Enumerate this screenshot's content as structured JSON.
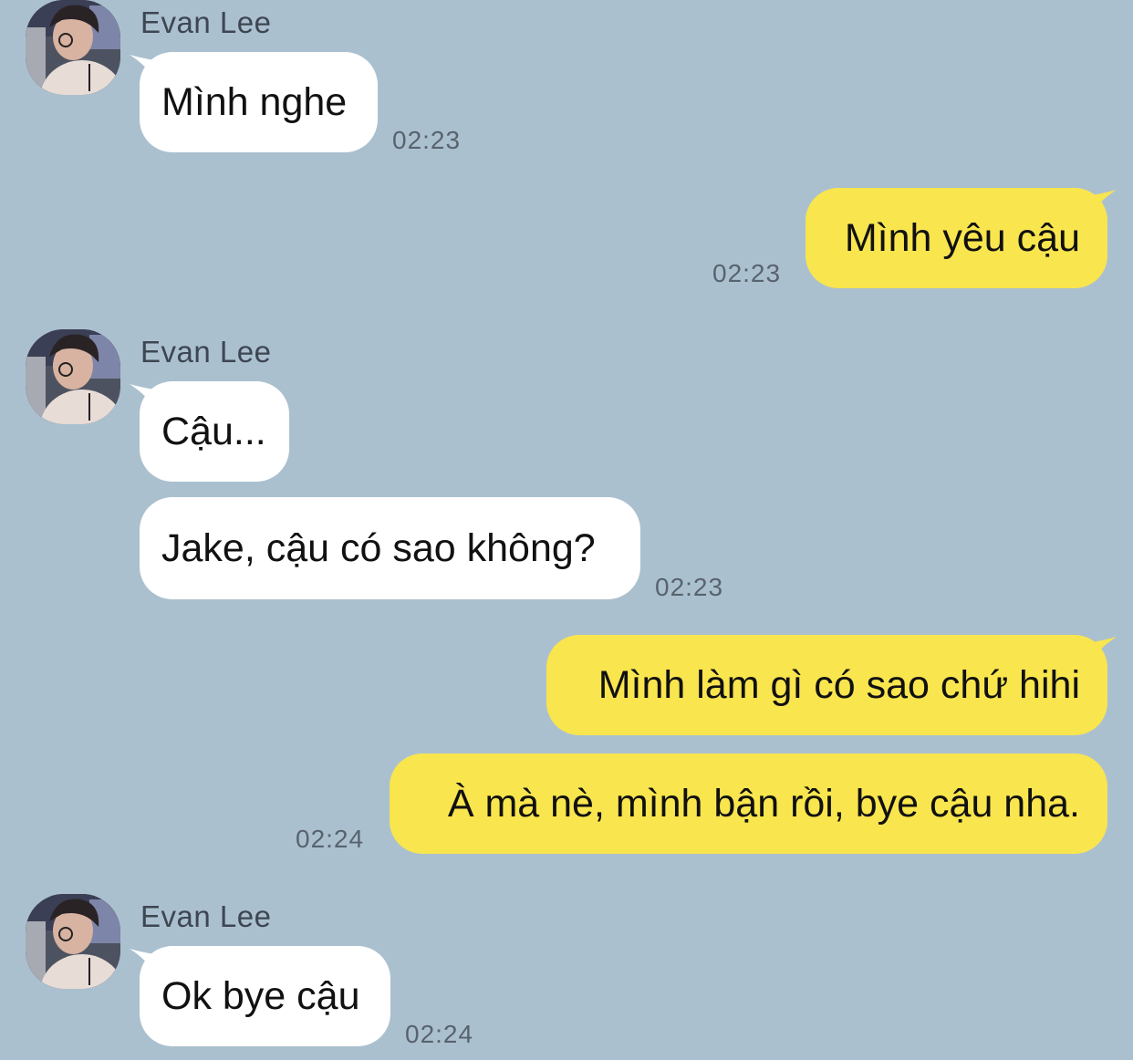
{
  "colors": {
    "background": "#abc0cf",
    "incoming_bubble": "#ffffff",
    "outgoing_bubble": "#f9e54e",
    "timestamp": "#58636e",
    "sender_name": "#3d4652"
  },
  "messages": [
    {
      "sender": "Evan Lee",
      "text": "Mình nghe",
      "time": "02:23"
    },
    {
      "text": "Mình yêu cậu",
      "time": "02:23"
    },
    {
      "sender": "Evan Lee",
      "text": "Cậu..."
    },
    {
      "text": "Jake, cậu có sao không?",
      "time": "02:23"
    },
    {
      "text": "Mình làm gì có sao chứ hihi"
    },
    {
      "text": "À mà nè, mình bận rồi, bye cậu nha.",
      "time": "02:24"
    },
    {
      "sender": "Evan Lee",
      "text": "Ok bye cậu",
      "time": "02:24"
    }
  ]
}
